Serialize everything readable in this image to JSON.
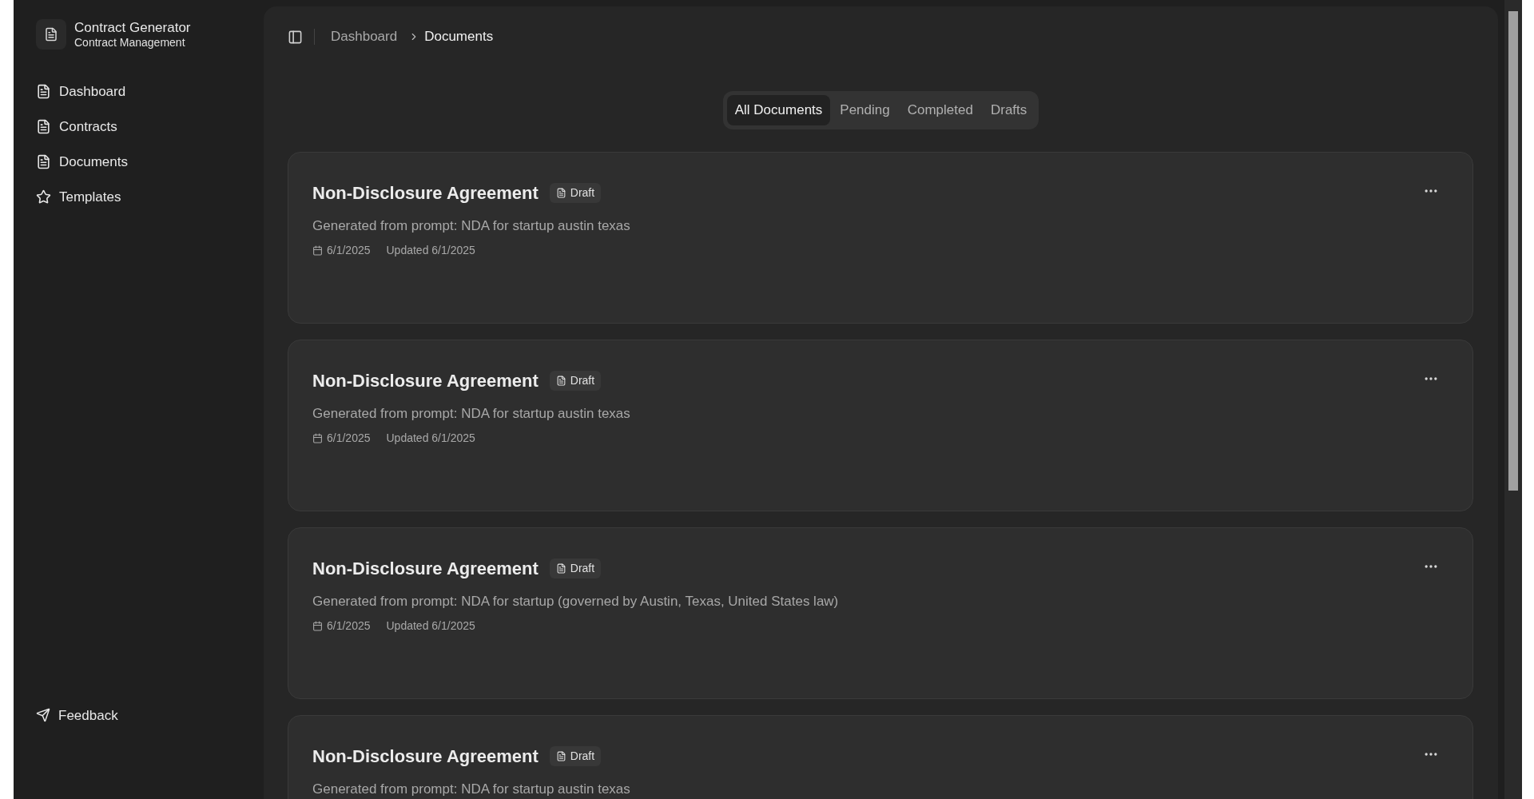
{
  "sidebar": {
    "app_title": "Contract Generator",
    "app_subtitle": "Contract Management",
    "items": [
      {
        "label": "Dashboard",
        "kind": "doc"
      },
      {
        "label": "Contracts",
        "kind": "doc"
      },
      {
        "label": "Documents",
        "kind": "doc"
      },
      {
        "label": "Templates",
        "kind": "star"
      }
    ],
    "footer": {
      "label": "Feedback"
    }
  },
  "breadcrumb": [
    "Dashboard",
    "Documents"
  ],
  "tabs": [
    {
      "label": "All Documents",
      "selected": true
    },
    {
      "label": "Pending",
      "selected": false
    },
    {
      "label": "Completed",
      "selected": false
    },
    {
      "label": "Drafts",
      "selected": false
    }
  ],
  "documents": [
    {
      "title": "Non-Disclosure Agreement",
      "badge": "Draft",
      "description": "Generated from prompt: NDA for startup austin texas",
      "created": "6/1/2025",
      "updated": "Updated 6/1/2025"
    },
    {
      "title": "Non-Disclosure Agreement",
      "badge": "Draft",
      "description": "Generated from prompt: NDA for startup austin texas",
      "created": "6/1/2025",
      "updated": "Updated 6/1/2025"
    },
    {
      "title": "Non-Disclosure Agreement",
      "badge": "Draft",
      "description": "Generated from prompt: NDA for startup (governed by Austin, Texas, United States law)",
      "created": "6/1/2025",
      "updated": "Updated 6/1/2025"
    },
    {
      "title": "Non-Disclosure Agreement",
      "badge": "Draft",
      "description": "Generated from prompt: NDA for startup austin texas"
    }
  ]
}
